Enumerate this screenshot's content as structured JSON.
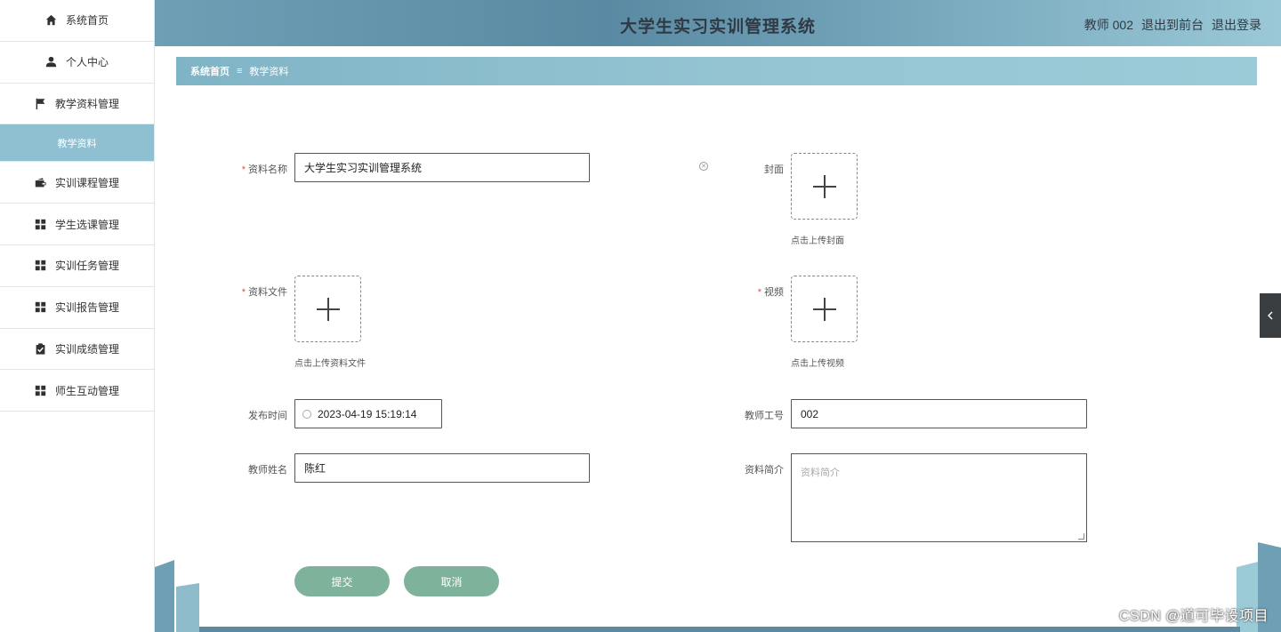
{
  "app": {
    "title": "大学生实习实训管理系统",
    "user": "教师 002",
    "goto_front": "退出到前台",
    "logout": "退出登录"
  },
  "sidebar": {
    "items": [
      {
        "label": "系统首页",
        "icon": "home-icon"
      },
      {
        "label": "个人中心",
        "icon": "user-icon"
      },
      {
        "label": "教学资料管理",
        "icon": "flag-icon"
      },
      {
        "label": "教学资料",
        "icon": ""
      },
      {
        "label": "实训课程管理",
        "icon": "wallet-icon"
      },
      {
        "label": "学生选课管理",
        "icon": "grid-icon"
      },
      {
        "label": "实训任务管理",
        "icon": "grid-icon"
      },
      {
        "label": "实训报告管理",
        "icon": "grid-icon"
      },
      {
        "label": "实训成绩管理",
        "icon": "clipboard-icon"
      },
      {
        "label": "师生互动管理",
        "icon": "grid-icon"
      }
    ]
  },
  "breadcrumb": {
    "home": "系统首页",
    "separator": "≡",
    "current": "教学资料"
  },
  "form": {
    "name_label": "资料名称",
    "name_value": "大学生实习实训管理系统",
    "cover_label": "封面",
    "cover_hint": "点击上传封面",
    "file_label": "资料文件",
    "file_hint": "点击上传资料文件",
    "video_label": "视频",
    "video_hint": "点击上传视频",
    "time_label": "发布时间",
    "time_value": "2023-04-19 15:19:14",
    "teacher_id_label": "教师工号",
    "teacher_id_value": "002",
    "teacher_name_label": "教师姓名",
    "teacher_name_value": "陈红",
    "intro_label": "资料简介",
    "intro_placeholder": "资料简介",
    "required_mark": "*"
  },
  "buttons": {
    "submit": "提交",
    "cancel": "取消"
  },
  "watermark": "CSDN @道可毕设项目",
  "colors": {
    "header": "#5a8aa3",
    "breadcrumb": "#94c4d2",
    "active_menu": "#8fc0d1",
    "button": "#7eb29b"
  }
}
